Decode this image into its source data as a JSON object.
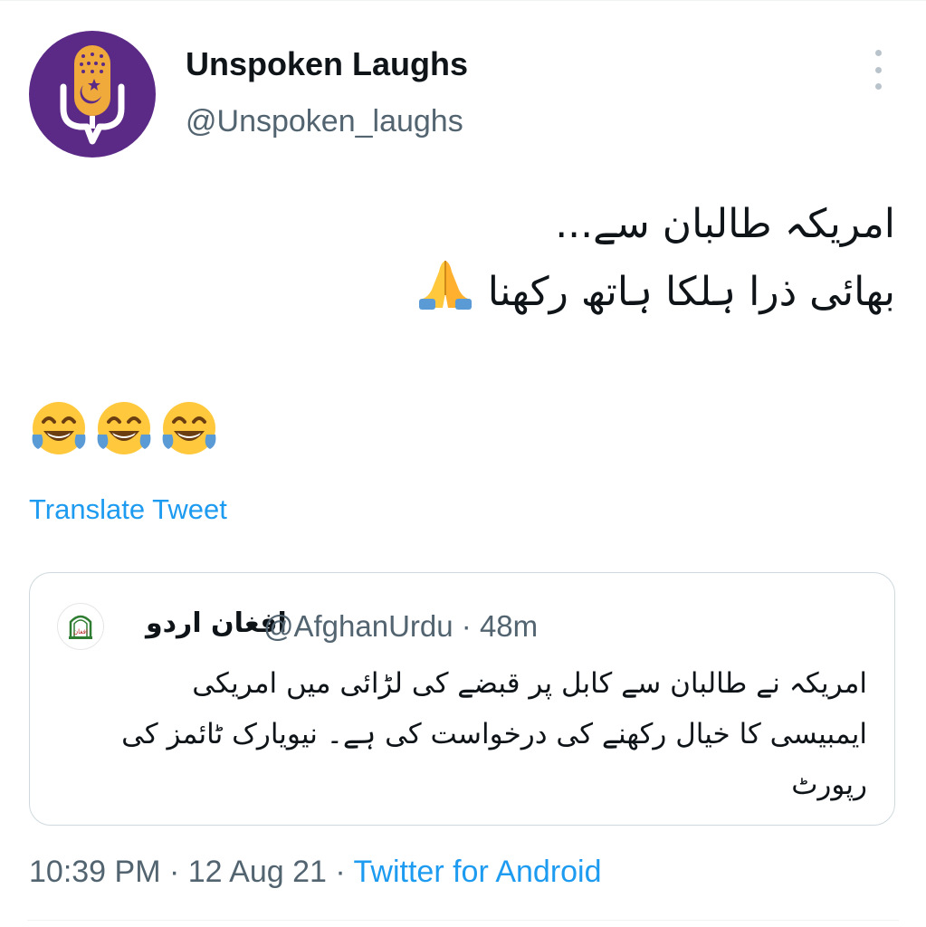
{
  "author": {
    "display_name": "Unspoken Laughs",
    "handle": "@Unspoken_laughs",
    "avatar_icon": "microphone-speech-bubble-logo",
    "avatar_bg": "#5b2a86",
    "avatar_accent": "#f0a93b"
  },
  "more_icon": "more-vertical-icon",
  "tweet": {
    "lines": [
      "امریکہ طالبان سے...",
      "بھائی ذرا ہلکا ہاتھ رکھنا"
    ],
    "pray_emoji": "folded-hands-emoji",
    "tears_emojis": [
      "tears-of-joy-emoji",
      "tears-of-joy-emoji",
      "tears-of-joy-emoji"
    ]
  },
  "translate_label": "Translate Tweet",
  "quote": {
    "name": "افغان اردو",
    "handle": "@AfghanUrdu",
    "time": "· 48m",
    "avatar_icon": "afghan-urdu-logo",
    "text_lines": [
      "امریکہ نے طالبان سے کابل پر قبضے کی لڑائی میں امریکی",
      "ایمبیسی کا خیال رکھنے کی درخواست کی ہے۔ نیویارک ٹائمز کی",
      "رپورٹ"
    ]
  },
  "meta": {
    "time": "10:39 PM",
    "sep1": " · ",
    "date": "12 Aug 21",
    "sep2": " · ",
    "source": "Twitter for Android"
  },
  "colors": {
    "link": "#1d9bf0",
    "secondary_text": "#536471",
    "border": "#cfd9de"
  }
}
